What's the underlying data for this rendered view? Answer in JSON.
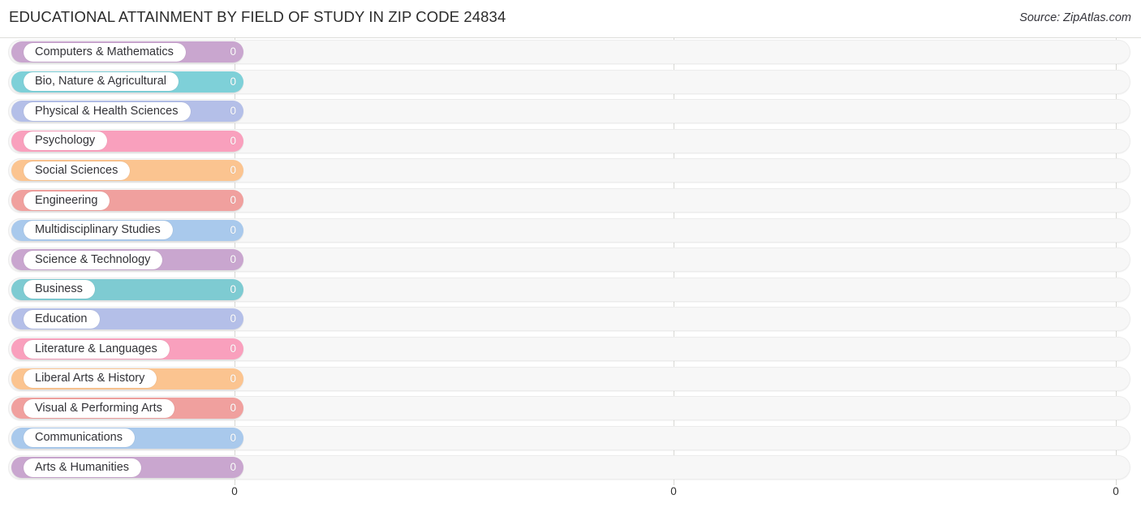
{
  "header": {
    "title": "EDUCATIONAL ATTAINMENT BY FIELD OF STUDY IN ZIP CODE 24834",
    "source": "Source: ZipAtlas.com"
  },
  "chart_data": {
    "type": "bar",
    "orientation": "horizontal",
    "title": "EDUCATIONAL ATTAINMENT BY FIELD OF STUDY IN ZIP CODE 24834",
    "subtitle": "",
    "xlabel": "",
    "ylabel": "",
    "grid": true,
    "legend": null,
    "xlim": [
      0,
      0
    ],
    "xticks": [
      0,
      0,
      0
    ],
    "xtick_labels": [
      "0",
      "0",
      "0"
    ],
    "categories": [
      "Computers & Mathematics",
      "Bio, Nature & Agricultural",
      "Physical & Health Sciences",
      "Psychology",
      "Social Sciences",
      "Engineering",
      "Multidisciplinary Studies",
      "Science & Technology",
      "Business",
      "Education",
      "Literature & Languages",
      "Liberal Arts & History",
      "Visual & Performing Arts",
      "Communications",
      "Arts & Humanities"
    ],
    "values": [
      0,
      0,
      0,
      0,
      0,
      0,
      0,
      0,
      0,
      0,
      0,
      0,
      0,
      0,
      0
    ],
    "value_labels": [
      "0",
      "0",
      "0",
      "0",
      "0",
      "0",
      "0",
      "0",
      "0",
      "0",
      "0",
      "0",
      "0",
      "0",
      "0"
    ],
    "colors": [
      "#c9a6cf",
      "#7ed0d8",
      "#b4bfe8",
      "#f9a0bd",
      "#fbc490",
      "#f0a09e",
      "#a9c9ec",
      "#c9a6cf",
      "#7ecbd2",
      "#b4bfe8",
      "#f9a0bd",
      "#fbc490",
      "#f0a09e",
      "#a9c9ec",
      "#c9a6cf"
    ]
  }
}
